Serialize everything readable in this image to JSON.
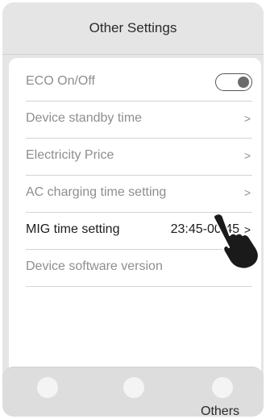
{
  "header": {
    "title": "Other Settings"
  },
  "settings": {
    "items": [
      {
        "label": "ECO On/Off",
        "control": "toggle",
        "on": true
      },
      {
        "label": "Device standby time",
        "chevron": ">"
      },
      {
        "label": "Electricity Price",
        "chevron": ">"
      },
      {
        "label": "AC charging time setting",
        "chevron": ">"
      },
      {
        "label": "MIG time setting",
        "value": "23:45-00:45",
        "chevron": ">"
      },
      {
        "label": "Device software version"
      }
    ]
  },
  "tabbar": {
    "others_label": "Others"
  },
  "icons": {
    "pointer": "pointing-hand-icon"
  },
  "colors": {
    "background": "#e5e5e5",
    "card": "#ffffff",
    "active_text": "#1c1c1c",
    "inactive_text": "#8e8e8e"
  }
}
